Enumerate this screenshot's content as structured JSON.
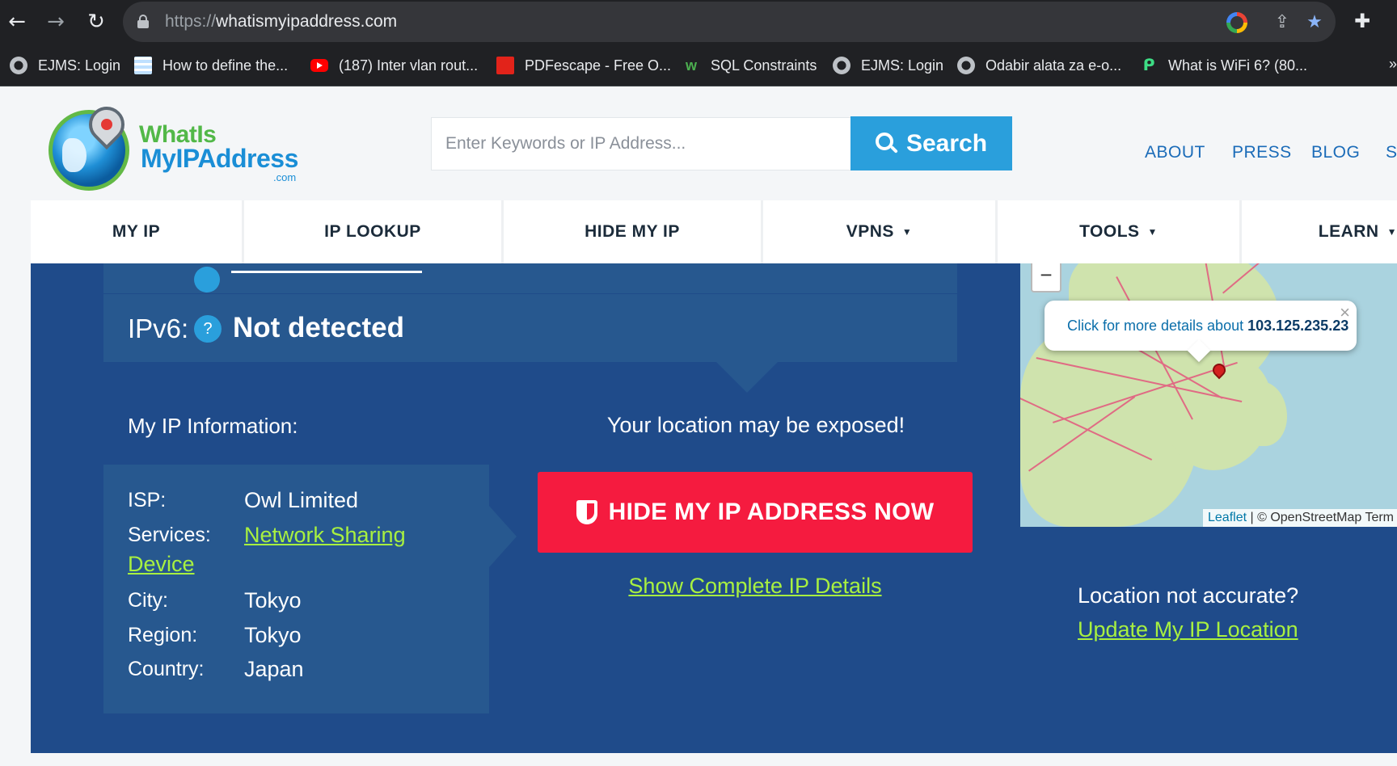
{
  "browser": {
    "url_scheme": "https://",
    "url_host": "whatismyipaddress.com",
    "bookmarks": [
      {
        "label": "EJMS: Login",
        "icon": "globe-icon"
      },
      {
        "label": "How to define the...",
        "icon": "sheet-icon"
      },
      {
        "label": "(187) Inter vlan rout...",
        "icon": "youtube-icon"
      },
      {
        "label": "PDFescape - Free O...",
        "icon": "pdf-icon"
      },
      {
        "label": "SQL Constraints",
        "icon": "w3schools-icon"
      },
      {
        "label": "EJMS: Login",
        "icon": "globe-icon"
      },
      {
        "label": "Odabir alata za e-o...",
        "icon": "globe-icon"
      },
      {
        "label": "What is WiFi 6? (80...",
        "icon": "wifi-icon"
      }
    ]
  },
  "header": {
    "logo": {
      "line1": "WhatIs",
      "line2": "MyIPAddress",
      "line3": ".com"
    },
    "search_placeholder": "Enter Keywords or IP Address...",
    "search_label": "Search",
    "links": [
      "ABOUT",
      "PRESS",
      "BLOG",
      "S"
    ]
  },
  "nav": {
    "items": [
      "MY IP",
      "IP LOOKUP",
      "HIDE MY IP",
      "VPNS",
      "TOOLS",
      "LEARN"
    ]
  },
  "ip": {
    "ipv6_label": "IPv6:",
    "help": "?",
    "ipv6_value": "Not detected"
  },
  "info": {
    "title": "My IP Information:",
    "isp_label": "ISP:",
    "isp_value": "Owl Limited",
    "services_label": "Services:",
    "services_value_line1": "Network Sharing",
    "services_value_line2": "Device",
    "city_label": "City:",
    "city_value": "Tokyo",
    "region_label": "Region:",
    "region_value": "Tokyo",
    "country_label": "Country:",
    "country_value": "Japan"
  },
  "cta": {
    "exposed_text": "Your location may be exposed!",
    "hide_button": "HIDE MY IP ADDRESS NOW",
    "details_link": "Show Complete IP Details"
  },
  "map": {
    "zoom_out": "−",
    "popup_text": "Click for more details about ",
    "popup_ip": "103.125.235.23",
    "popup_close": "×",
    "attribution_leaflet": "Leaflet",
    "attribution_rest": " | © OpenStreetMap Term"
  },
  "location": {
    "question": "Location not accurate?",
    "update_link": "Update My IP Location"
  },
  "colors": {
    "chrome_bg": "#202124",
    "site_blue": "#1f4b8a",
    "card_blue": "#27588f",
    "accent_blue": "#2a9fdc",
    "cta_red": "#f51b3f",
    "link_green": "#a8f040"
  }
}
